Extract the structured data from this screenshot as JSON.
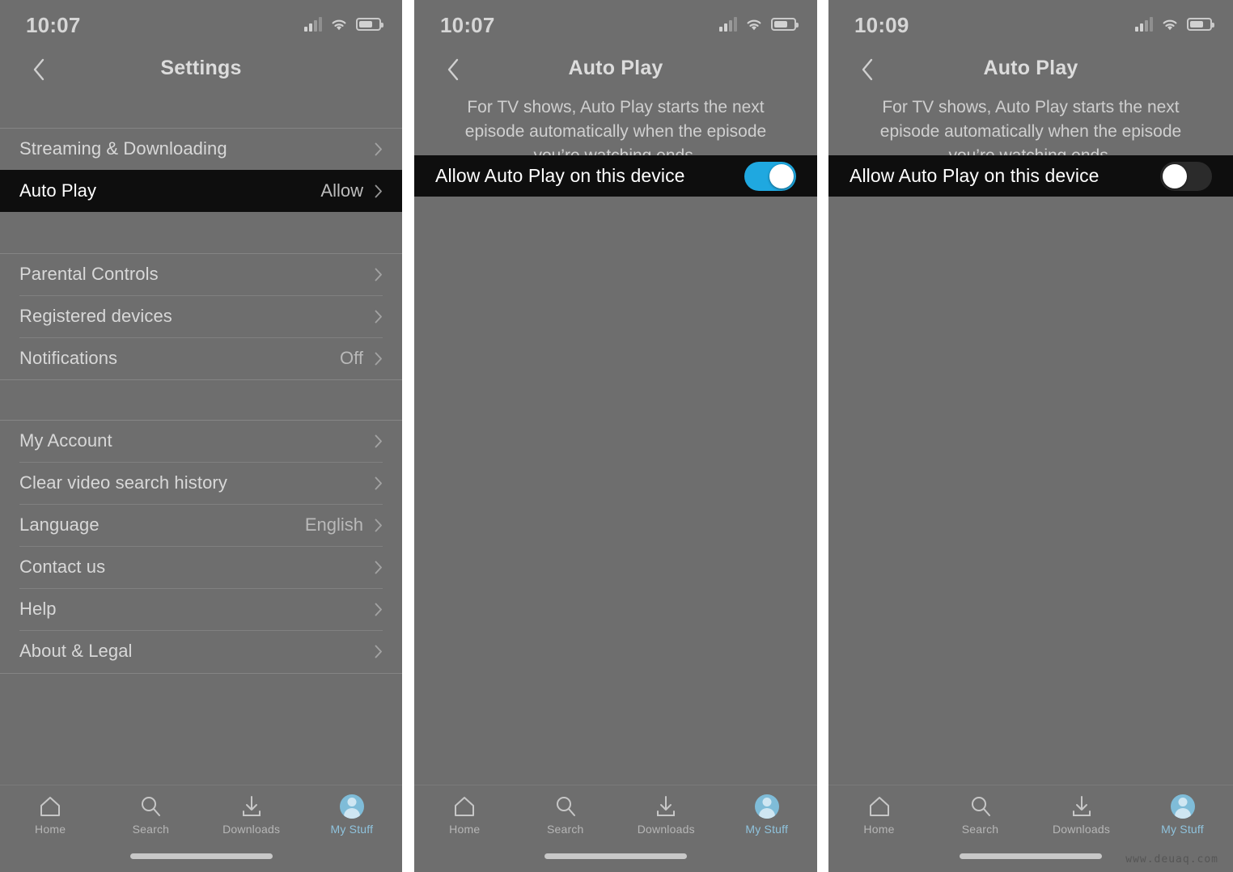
{
  "colors": {
    "dim_background": "#6e6e6e",
    "highlight_row": "#0e0e0e",
    "toggle_on": "#1fa8e0",
    "toggle_off_track": "#2b2b2b",
    "tab_active": "#8fc3dd"
  },
  "panels": [
    {
      "id": "settings",
      "status": {
        "time": "10:07",
        "signal_icon": "cellular-signal-icon",
        "wifi_icon": "wifi-icon",
        "battery_icon": "battery-icon"
      },
      "nav": {
        "back_icon": "chevron-left-icon",
        "title": "Settings"
      },
      "groups": [
        {
          "items": [
            {
              "label": "Streaming & Downloading",
              "value": "",
              "chevron": true,
              "highlight": false
            },
            {
              "label": "Auto Play",
              "value": "Allow",
              "chevron": true,
              "highlight": true
            }
          ]
        },
        {
          "items": [
            {
              "label": "Parental Controls",
              "value": "",
              "chevron": true,
              "highlight": false
            },
            {
              "label": "Registered devices",
              "value": "",
              "chevron": true,
              "highlight": false
            },
            {
              "label": "Notifications",
              "value": "Off",
              "chevron": true,
              "highlight": false
            }
          ]
        },
        {
          "items": [
            {
              "label": "My Account",
              "value": "",
              "chevron": true,
              "highlight": false
            },
            {
              "label": "Clear video search history",
              "value": "",
              "chevron": true,
              "highlight": false
            },
            {
              "label": "Language",
              "value": "English",
              "chevron": true,
              "highlight": false
            },
            {
              "label": "Contact us",
              "value": "",
              "chevron": true,
              "highlight": false
            },
            {
              "label": "Help",
              "value": "",
              "chevron": true,
              "highlight": false
            },
            {
              "label": "About & Legal",
              "value": "",
              "chevron": true,
              "highlight": false
            }
          ]
        }
      ],
      "tabbar": [
        {
          "label": "Home",
          "icon": "home-icon",
          "active": false
        },
        {
          "label": "Search",
          "icon": "search-icon",
          "active": false
        },
        {
          "label": "Downloads",
          "icon": "download-icon",
          "active": false
        },
        {
          "label": "My Stuff",
          "icon": "avatar-icon",
          "active": true
        }
      ]
    },
    {
      "id": "autoplay-on",
      "status": {
        "time": "10:07",
        "signal_icon": "cellular-signal-icon",
        "wifi_icon": "wifi-icon",
        "battery_icon": "battery-icon"
      },
      "nav": {
        "back_icon": "chevron-left-icon",
        "title": "Auto Play"
      },
      "description": "For TV shows, Auto Play starts the next episode automatically when the episode you’re watching ends.",
      "toggle": {
        "label": "Allow Auto Play on this device",
        "state": "on"
      },
      "tabbar": [
        {
          "label": "Home",
          "icon": "home-icon",
          "active": false
        },
        {
          "label": "Search",
          "icon": "search-icon",
          "active": false
        },
        {
          "label": "Downloads",
          "icon": "download-icon",
          "active": false
        },
        {
          "label": "My Stuff",
          "icon": "avatar-icon",
          "active": true
        }
      ]
    },
    {
      "id": "autoplay-off",
      "status": {
        "time": "10:09",
        "signal_icon": "cellular-signal-icon",
        "wifi_icon": "wifi-icon",
        "battery_icon": "battery-icon"
      },
      "nav": {
        "back_icon": "chevron-left-icon",
        "title": "Auto Play"
      },
      "description": "For TV shows, Auto Play starts the next episode automatically when the episode you’re watching ends.",
      "toggle": {
        "label": "Allow Auto Play on this device",
        "state": "off"
      },
      "tabbar": [
        {
          "label": "Home",
          "icon": "home-icon",
          "active": false
        },
        {
          "label": "Search",
          "icon": "search-icon",
          "active": false
        },
        {
          "label": "Downloads",
          "icon": "download-icon",
          "active": false
        },
        {
          "label": "My Stuff",
          "icon": "avatar-icon",
          "active": true
        }
      ]
    }
  ],
  "watermark": "www.deuaq.com"
}
